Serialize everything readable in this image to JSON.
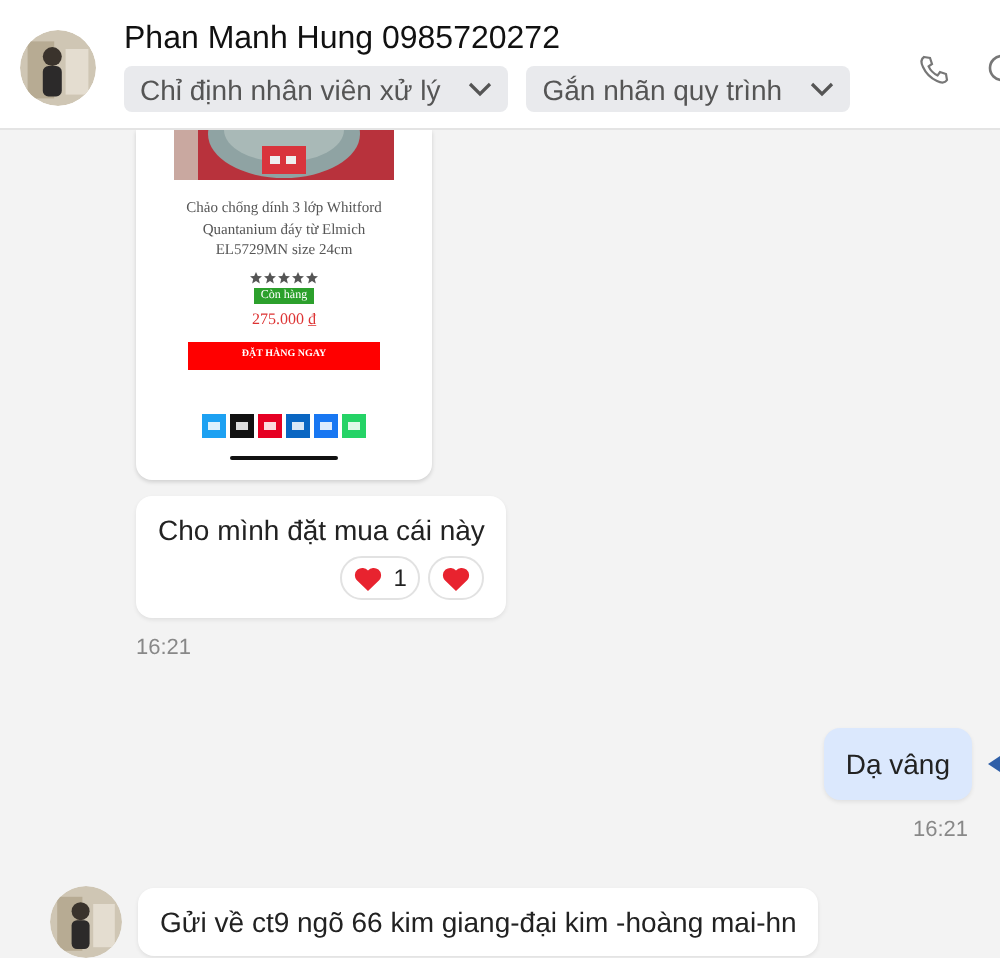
{
  "header": {
    "contact_name": "Phan Manh Hung 0985720272",
    "dropdowns": [
      {
        "label": "Chỉ định nhân viên xử lý"
      },
      {
        "label": "Gắn nhãn quy trình"
      }
    ]
  },
  "messages": [
    {
      "kind": "product",
      "product": {
        "title": "Chảo chống dính 3 lớp Whitford Quantanium đáy từ Elmich EL5729MN size 24cm",
        "stars": 5,
        "stock": "Còn hàng",
        "price": "275.000 ₫",
        "order_button": "ĐẶT HÀNG NGAY"
      }
    },
    {
      "kind": "text",
      "outgoing": false,
      "text": "Cho mình đặt mua cái này",
      "reactions": [
        {
          "count": "1"
        }
      ],
      "my_reaction": true,
      "time": "16:21"
    },
    {
      "kind": "text",
      "outgoing": true,
      "text": "Dạ vâng",
      "time": "16:21"
    },
    {
      "kind": "text",
      "outgoing": false,
      "avatar": true,
      "text": "Gửi về ct9 ngõ 66 kim giang-đại kim -hoàng mai-hn"
    }
  ]
}
